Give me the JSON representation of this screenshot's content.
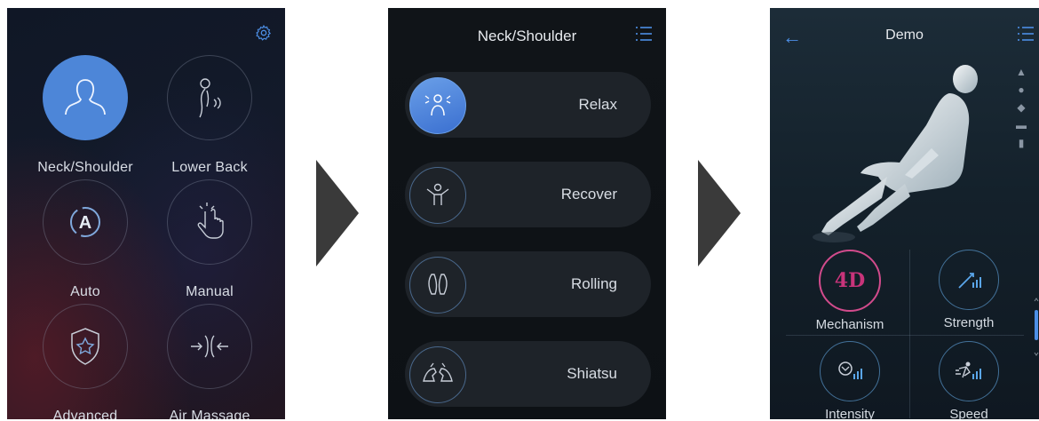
{
  "screen1": {
    "items": [
      {
        "label": "Neck/Shoulder",
        "icon": "person-bust-icon",
        "active": true
      },
      {
        "label": "Lower Back",
        "icon": "lower-back-icon",
        "active": false
      },
      {
        "label": "Auto",
        "icon": "auto-cycle-icon",
        "active": false
      },
      {
        "label": "Manual",
        "icon": "hand-tap-icon",
        "active": false
      },
      {
        "label": "Advanced",
        "icon": "star-shield-icon",
        "active": false
      },
      {
        "label": "Air Massage",
        "icon": "air-arrows-icon",
        "active": false
      }
    ],
    "settings_icon": "gear-icon"
  },
  "screen2": {
    "title": "Neck/Shoulder",
    "programs": [
      {
        "label": "Relax",
        "icon": "relax-person-icon",
        "active": true
      },
      {
        "label": "Recover",
        "icon": "recover-person-icon",
        "active": false
      },
      {
        "label": "Rolling",
        "icon": "rolling-hands-icon",
        "active": false
      },
      {
        "label": "Shiatsu",
        "icon": "shiatsu-hands-icon",
        "active": false
      }
    ]
  },
  "screen3": {
    "title": "Demo",
    "controls": [
      {
        "label": "Mechanism",
        "icon_text": "4D"
      },
      {
        "label": "Strength",
        "icon": "strength-icon"
      },
      {
        "label": "Intensity",
        "icon": "intensity-icon"
      },
      {
        "label": "Speed",
        "icon": "speed-icon"
      }
    ]
  },
  "colors": {
    "accent_blue": "#4d86d8",
    "fourd_pink": "#d24b8c",
    "arrow": "#3a3a3a"
  }
}
